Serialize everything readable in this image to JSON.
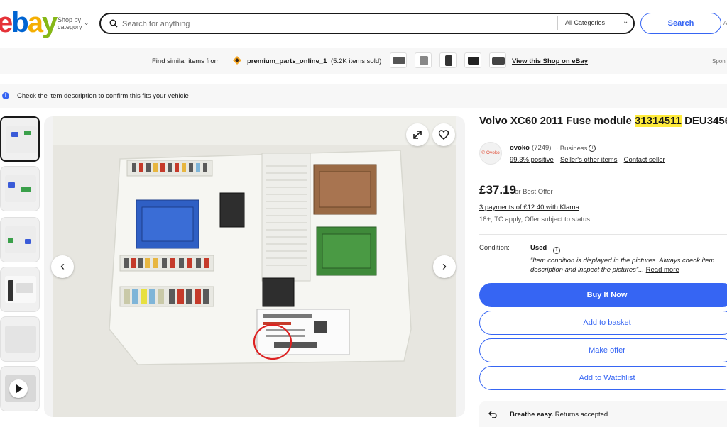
{
  "header": {
    "logo_letters": [
      "e",
      "b",
      "a",
      "y"
    ],
    "logo_colors": [
      "#e53238",
      "#0064d2",
      "#f5af02",
      "#86b817"
    ],
    "shop_by": [
      "Shop by",
      "category"
    ],
    "search_placeholder": "Search for anything",
    "category": "All Categories",
    "search_button": "Search",
    "advanced": "A"
  },
  "similar_bar": {
    "prefix": "Find similar items from",
    "shop_name": "premium_parts_online_1",
    "sold": "(5.2K items sold)",
    "view_shop": "View this Shop on eBay",
    "sponsored": "Spon"
  },
  "notice": {
    "text": "Check the item description to confirm this fits your vehicle"
  },
  "gallery": {
    "thumbnail_count": 7,
    "active_index": 0
  },
  "listing": {
    "title_before": "Volvo XC60 2011 Fuse module ",
    "title_highlight": "31314511",
    "title_after": " DEU3456",
    "seller": {
      "avatar_text": "© Ovoko",
      "name": "ovoko",
      "feedback_count": "(7249)",
      "type": "· Business",
      "positive": "99.3% positive",
      "other_items": "Seller's other items",
      "contact": "Contact seller"
    },
    "price": "£37.19",
    "best_offer": "or Best Offer",
    "klarna": "3 payments of £12.40 with Klarna",
    "klarna_sub": "18+, TC apply, Offer subject to status.",
    "condition_label": "Condition:",
    "condition_value": "Used",
    "condition_desc_line1": "“Item condition is displayed in the pictures. Always check item",
    "condition_desc_line2": "description and inspect the pictures”...",
    "read_more": "Read more",
    "buttons": {
      "buy_now": "Buy It Now",
      "add_basket": "Add to basket",
      "make_offer": "Make offer",
      "watchlist": "Add to Watchlist"
    },
    "returns_bold": "Breathe easy.",
    "returns_text": " Returns accepted."
  }
}
